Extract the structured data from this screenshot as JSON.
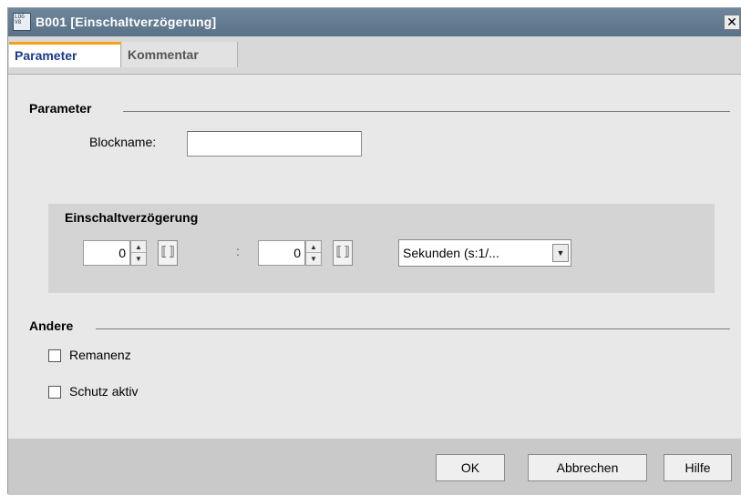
{
  "window": {
    "title": "B001 [Einschaltverzögerung]",
    "icon": "logo-app-icon",
    "icon_text": [
      "LOG",
      "V8"
    ],
    "close_glyph": "✕"
  },
  "tabs": [
    {
      "label": "Parameter",
      "active": true
    },
    {
      "label": "Kommentar",
      "active": false
    }
  ],
  "parameter_section": {
    "title": "Parameter",
    "blockname_label": "Blockname:",
    "blockname_value": ""
  },
  "delay_group": {
    "title": "Einschaltverzögerung",
    "value1": "0",
    "value2": "0",
    "separator": ":",
    "unit_selected": "Sekunden (s:1/..."
  },
  "other_section": {
    "title": "Andere",
    "remanence_label": "Remanenz",
    "remanence_checked": false,
    "protection_label": "Schutz aktiv",
    "protection_checked": false
  },
  "buttons": {
    "ok": "OK",
    "cancel": "Abbrechen",
    "help": "Hilfe"
  },
  "colors": {
    "titlebar": "#5f778c",
    "active_tab_text": "#1a3a8a",
    "active_tab_accent": "#f3a21a"
  }
}
